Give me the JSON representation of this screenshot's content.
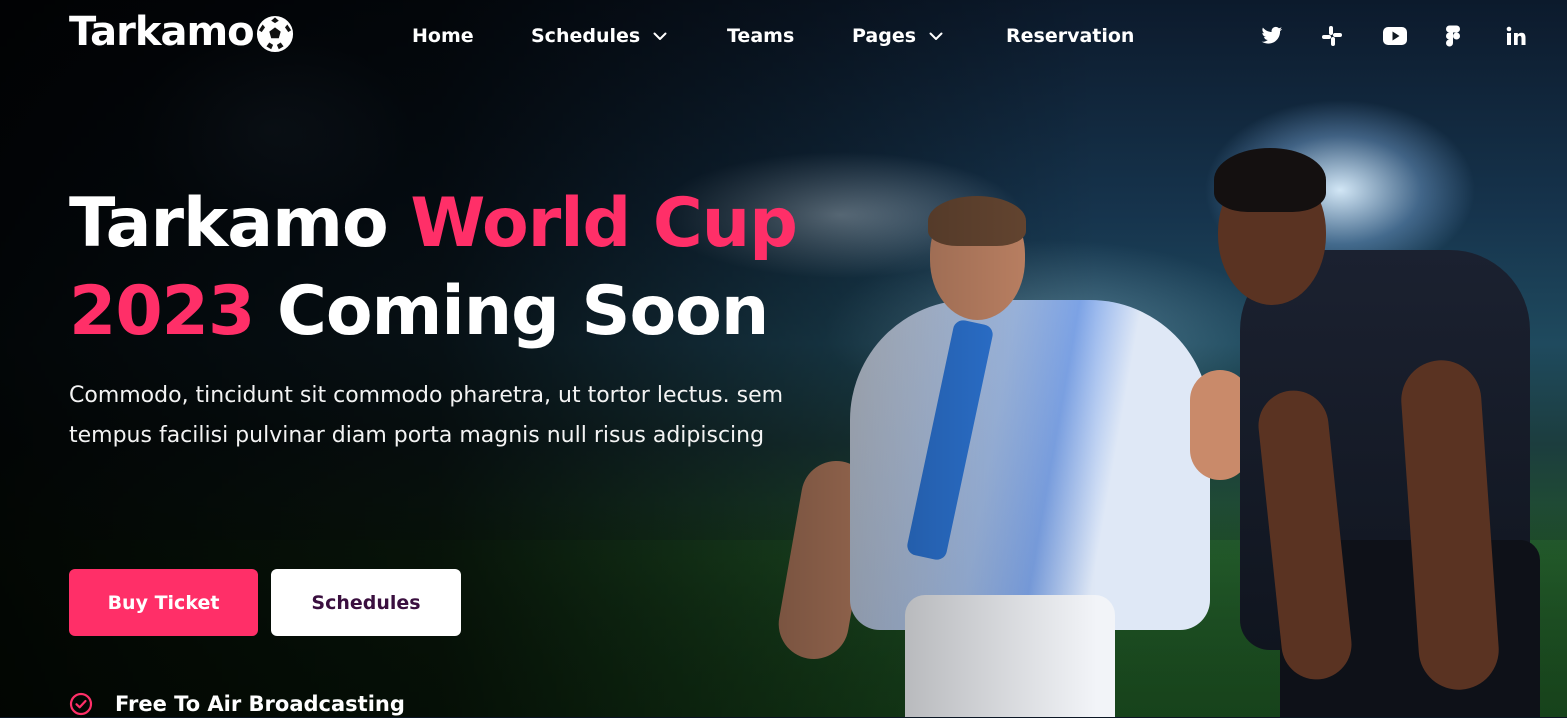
{
  "brand": {
    "name": "Tarkamo",
    "logo_icon": "soccer-ball-icon"
  },
  "nav": {
    "items": [
      {
        "label": "Home",
        "has_dropdown": false
      },
      {
        "label": "Schedules",
        "has_dropdown": true
      },
      {
        "label": "Teams",
        "has_dropdown": false
      },
      {
        "label": "Pages",
        "has_dropdown": true
      },
      {
        "label": "Reservation",
        "has_dropdown": false
      }
    ]
  },
  "social": [
    "twitter-icon",
    "slack-icon",
    "youtube-icon",
    "figma-icon",
    "linkedin-icon"
  ],
  "hero": {
    "title_part1": "Tarkamo ",
    "title_accent1": "World Cup",
    "title_accent2": "2023",
    "title_part2": " Coming Soon",
    "description": "Commodo, tincidunt sit commodo pharetra, ut tortor lectus. sem tempus facilisi pulvinar diam porta magnis null risus adipiscing",
    "buy_label": "Buy Ticket",
    "schedules_label": "Schedules",
    "feature_label": "Free To Air Broadcasting"
  },
  "colors": {
    "accent": "#ff2f68",
    "secondary_button_text": "#3a0f3f",
    "white": "#ffffff"
  }
}
